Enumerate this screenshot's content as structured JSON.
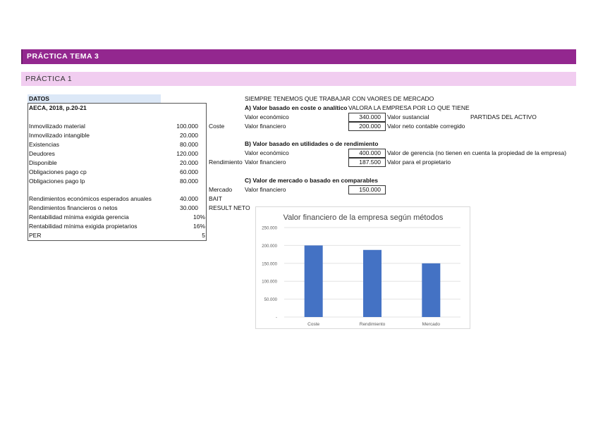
{
  "header": {
    "title": "PRÁCTICA TEMA 3",
    "subtitle": "PRÁCTICA 1"
  },
  "datos": {
    "label": "DATOS",
    "source": "AECA, 2018, p.20-21",
    "rows": [
      {
        "label": "Inmovilizado material",
        "value": "100.000"
      },
      {
        "label": "Inmovilizado intangible",
        "value": "20.000"
      },
      {
        "label": "Existencias",
        "value": "80.000"
      },
      {
        "label": "Deudores",
        "value": "120.000"
      },
      {
        "label": "Disponible",
        "value": "20.000"
      },
      {
        "label": "Obligaciones pago cp",
        "value": "60.000"
      },
      {
        "label": "Obligaciones pago lp",
        "value": "80.000"
      }
    ],
    "rows2": [
      {
        "label": "Rendimientos económicos esperados anuales",
        "value": "40.000"
      },
      {
        "label": "Rendimientos financieros o netos",
        "value": "30.000"
      },
      {
        "label": "Rentabilidad mínima exigida gerencia",
        "value": "10%"
      },
      {
        "label": "Rentabilidad mínima exigida propietarios",
        "value": "16%"
      },
      {
        "label": "PER",
        "value": "5"
      }
    ]
  },
  "side_labels": {
    "coste": "Coste",
    "rendimiento": "Rendimiento",
    "mercado": "Mercado",
    "bait": "BAIT",
    "result_neto": "RESULT NETO"
  },
  "valuation": {
    "note": "SIEMPRE TENEMOS QUE  TRABAJAR CON VAORES DE MERCADO",
    "a_title": "A) Valor basado en coste o analítico",
    "a_note": "VALORA LA EMPRESA POR LO QUE TIENE",
    "a_rows": [
      {
        "label": "Valor económico",
        "value": "340.000",
        "desc": "Valor sustancial"
      },
      {
        "label": "Valor financiero",
        "value": "200.000",
        "desc": "Valor neto contable corregido"
      }
    ],
    "a_extra": "PARTIDAS DEL ACTIVO",
    "b_title": "B) Valor basado en utilidades o de rendimiento",
    "b_rows": [
      {
        "label": "Valor económico",
        "value": "400.000",
        "desc": "Valor de gerencia (no tienen en cuenta la propiedad de la empresa)"
      },
      {
        "label": "Valor financiero",
        "value": "187.500",
        "desc": "Valor para el propietario"
      }
    ],
    "c_title": "C) Valor de mercado o basado en comparables",
    "c_rows": [
      {
        "label": "Valor financiero",
        "value": "150.000"
      }
    ]
  },
  "chart_data": {
    "type": "bar",
    "title": "Valor financiero de la empresa según métodos",
    "categories": [
      "Coste",
      "Rendimiento",
      "Mercado"
    ],
    "values": [
      200000,
      187500,
      150000
    ],
    "ylim": [
      0,
      250000
    ],
    "yticks": [
      "-",
      "50.000",
      "100.000",
      "150.000",
      "200.000",
      "250.000"
    ],
    "color": "#4472c4",
    "grid": true
  }
}
